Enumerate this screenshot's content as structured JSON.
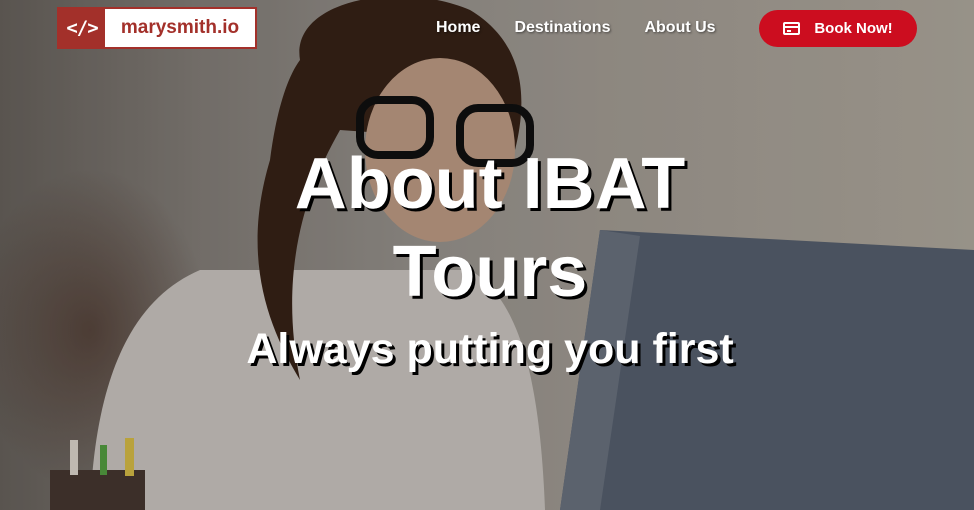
{
  "brand": {
    "logo_mark": "</>",
    "logo_text": "marysmith.io"
  },
  "nav": {
    "items": [
      {
        "label": "Home"
      },
      {
        "label": "Destinations"
      },
      {
        "label": "About Us"
      }
    ],
    "cta": {
      "label": "Book Now!",
      "icon": "credit-card-icon"
    }
  },
  "hero": {
    "title_line1": "About IBAT",
    "title_line2": "Tours",
    "subtitle": "Always putting you first"
  },
  "colors": {
    "brand_red": "#a3302a",
    "cta_red": "#cc0d1f",
    "text": "#ffffff"
  }
}
